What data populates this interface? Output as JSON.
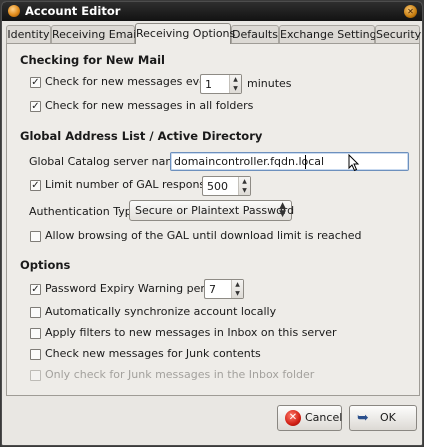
{
  "window": {
    "title": "Account Editor"
  },
  "tabs": [
    {
      "label": "Identity"
    },
    {
      "label": "Receiving Email"
    },
    {
      "label": "Receiving Options"
    },
    {
      "label": "Defaults"
    },
    {
      "label": "Exchange Settings"
    },
    {
      "label": "Security"
    }
  ],
  "active_tab": "Receiving Options",
  "new_mail": {
    "title": "Checking for New Mail",
    "check_every_label": "Check for new messages every",
    "check_every_value": "1",
    "check_every_unit": "minutes",
    "check_every_checked": true,
    "all_folders_label": "Check for new messages in all folders",
    "all_folders_checked": true
  },
  "gal": {
    "title": "Global Address List / Active Directory",
    "server_label": "Global Catalog server name:",
    "server_value": "domaincontroller.fqdn.local",
    "limit_label": "Limit number of GAL responses:",
    "limit_value": "500",
    "limit_checked": true,
    "auth_label": "Authentication Type:",
    "auth_value": "Secure or Plaintext Password",
    "browse_label": "Allow browsing of the GAL until download limit is reached",
    "browse_checked": false
  },
  "options": {
    "title": "Options",
    "expiry_label": "Password Expiry Warning period:",
    "expiry_value": "7",
    "expiry_checked": true,
    "sync_label": "Automatically synchronize account locally",
    "sync_checked": false,
    "filters_label": "Apply filters to new messages in Inbox on this server",
    "filters_checked": false,
    "junk_label": "Check new messages for Junk contents",
    "junk_checked": false,
    "junk_inbox_label": "Only check for Junk messages in the Inbox folder",
    "junk_inbox_checked": false,
    "junk_inbox_enabled": false
  },
  "buttons": {
    "cancel": "Cancel",
    "ok": "OK"
  },
  "icons": {
    "app": "evolution-app-icon",
    "close": "close-icon",
    "cancel": "cancel-icon",
    "ok": "ok-icon",
    "check": "checkmark-icon",
    "spin": "spin-arrows-icon",
    "dropdown": "dropdown-arrows-icon",
    "cursor": "ibeam-cursor-icon"
  },
  "colors": {
    "titlebar": "#1e1e1e",
    "window_bg": "#e9e7e3",
    "focus_border": "#6d90bd"
  }
}
